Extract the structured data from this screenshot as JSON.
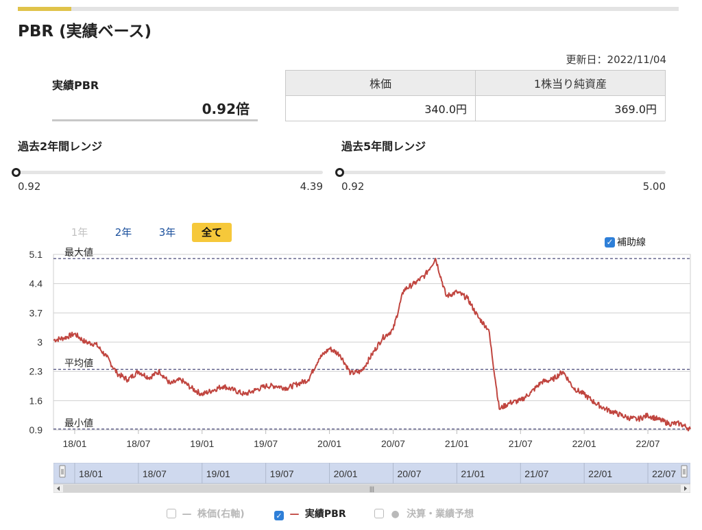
{
  "page_title": "PBR (実績ベース)",
  "updated": "更新日：2022/11/04",
  "pbr": {
    "label": "実績PBR",
    "value": "0.92倍"
  },
  "stock_table": {
    "headers": [
      "株価",
      "1株当り純資産"
    ],
    "values": [
      "340.0円",
      "369.0円"
    ]
  },
  "range_2y": {
    "title": "過去2年間レンジ",
    "min": "0.92",
    "max": "4.39",
    "current_fraction": 0
  },
  "range_5y": {
    "title": "過去5年間レンジ",
    "min": "0.92",
    "max": "5.00",
    "current_fraction": 0
  },
  "period_tabs": [
    {
      "label": "1年",
      "state": "disabled"
    },
    {
      "label": "2年",
      "state": "link"
    },
    {
      "label": "3年",
      "state": "link"
    },
    {
      "label": "全て",
      "state": "active"
    }
  ],
  "aux_line": {
    "label": "補助線",
    "checked": true
  },
  "colors": {
    "accent": "#e0c34a",
    "line": "#c0453f",
    "active_tab": "#f6c83a",
    "link": "#1a4f9c",
    "ref_line": "#4a4a7a",
    "navigator": "#cfd9ee"
  },
  "chart_data": {
    "type": "line",
    "title": "",
    "xlabel": "",
    "ylabel": "",
    "ylim": [
      0.9,
      5.1
    ],
    "y_ticks": [
      "5.1",
      "4.4",
      "3.7",
      "3",
      "2.3",
      "1.6",
      "0.9"
    ],
    "x_ticks": [
      "18/01",
      "18/07",
      "19/01",
      "19/07",
      "20/01",
      "20/07",
      "21/01",
      "21/07",
      "22/01",
      "22/07"
    ],
    "x_range": [
      "2017-11",
      "2022-11"
    ],
    "grid": true,
    "reference_lines": [
      {
        "label": "最大値",
        "value": 5.0
      },
      {
        "label": "平均値",
        "value": 2.35
      },
      {
        "label": "最小値",
        "value": 0.92
      }
    ],
    "series": [
      {
        "name": "実績PBR",
        "points": [
          [
            "2017-11",
            3.05
          ],
          [
            "2017-12",
            3.1
          ],
          [
            "2018-01",
            3.2
          ],
          [
            "2018-02",
            3.0
          ],
          [
            "2018-03",
            2.95
          ],
          [
            "2018-04",
            2.65
          ],
          [
            "2018-05",
            2.25
          ],
          [
            "2018-06",
            2.1
          ],
          [
            "2018-07",
            2.3
          ],
          [
            "2018-08",
            2.15
          ],
          [
            "2018-09",
            2.3
          ],
          [
            "2018-10",
            2.0
          ],
          [
            "2018-11",
            2.1
          ],
          [
            "2018-12",
            1.9
          ],
          [
            "2019-01",
            1.75
          ],
          [
            "2019-02",
            1.85
          ],
          [
            "2019-03",
            1.95
          ],
          [
            "2019-04",
            1.85
          ],
          [
            "2019-05",
            1.75
          ],
          [
            "2019-06",
            1.85
          ],
          [
            "2019-07",
            1.95
          ],
          [
            "2019-08",
            1.95
          ],
          [
            "2019-09",
            1.9
          ],
          [
            "2019-10",
            2.0
          ],
          [
            "2019-11",
            2.1
          ],
          [
            "2019-12",
            2.6
          ],
          [
            "2020-01",
            2.85
          ],
          [
            "2020-02",
            2.7
          ],
          [
            "2020-03",
            2.25
          ],
          [
            "2020-04",
            2.3
          ],
          [
            "2020-05",
            2.7
          ],
          [
            "2020-06",
            3.1
          ],
          [
            "2020-07",
            3.3
          ],
          [
            "2020-08",
            4.25
          ],
          [
            "2020-09",
            4.4
          ],
          [
            "2020-10",
            4.6
          ],
          [
            "2020-11",
            5.0
          ],
          [
            "2020-12",
            4.1
          ],
          [
            "2021-01",
            4.2
          ],
          [
            "2021-02",
            4.05
          ],
          [
            "2021-03",
            3.6
          ],
          [
            "2021-04",
            3.3
          ],
          [
            "2021-05",
            1.4
          ],
          [
            "2021-06",
            1.55
          ],
          [
            "2021-07",
            1.6
          ],
          [
            "2021-08",
            1.8
          ],
          [
            "2021-09",
            2.05
          ],
          [
            "2021-10",
            2.1
          ],
          [
            "2021-11",
            2.3
          ],
          [
            "2021-12",
            1.9
          ],
          [
            "2022-01",
            1.75
          ],
          [
            "2022-02",
            1.55
          ],
          [
            "2022-03",
            1.4
          ],
          [
            "2022-04",
            1.3
          ],
          [
            "2022-05",
            1.2
          ],
          [
            "2022-06",
            1.15
          ],
          [
            "2022-07",
            1.25
          ],
          [
            "2022-08",
            1.15
          ],
          [
            "2022-09",
            1.05
          ],
          [
            "2022-10",
            1.05
          ],
          [
            "2022-11",
            0.92
          ]
        ]
      }
    ]
  },
  "navigator": {
    "labels": [
      "18/01",
      "18/07",
      "19/01",
      "19/07",
      "20/01",
      "20/07",
      "21/01",
      "21/07",
      "22/01",
      "22/07"
    ],
    "scroll_grip": "|||"
  },
  "legend": [
    {
      "label": "株価(右軸)",
      "checked": false,
      "enabled": false,
      "marker": "line"
    },
    {
      "label": "実績PBR",
      "checked": true,
      "enabled": true,
      "marker": "line"
    },
    {
      "label": "決算・業績予想",
      "checked": false,
      "enabled": false,
      "marker": "dot"
    }
  ]
}
